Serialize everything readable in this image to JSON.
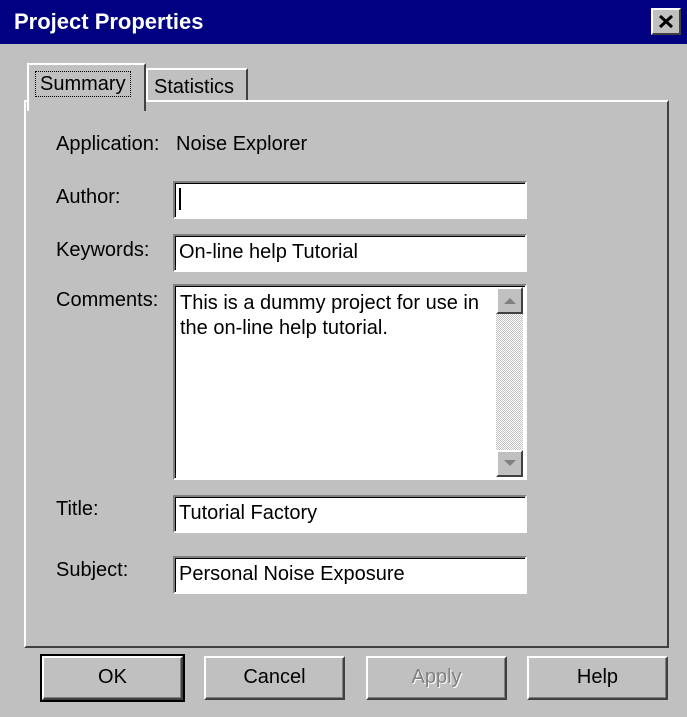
{
  "window": {
    "title": "Project Properties"
  },
  "tabs": [
    {
      "label": "Summary",
      "selected": true
    },
    {
      "label": "Statistics",
      "selected": false
    }
  ],
  "summary": {
    "application_label": "Application:",
    "application_value": "Noise Explorer",
    "author_label": "Author:",
    "author_value": "",
    "keywords_label": "Keywords:",
    "keywords_value": "On-line help Tutorial",
    "comments_label": "Comments:",
    "comments_value": "This is a dummy project for use in\nthe on-line help tutorial.",
    "title_label": "Title:",
    "title_value": "Tutorial Factory",
    "subject_label": "Subject:",
    "subject_value": "Personal Noise Exposure"
  },
  "buttons": {
    "ok": "OK",
    "cancel": "Cancel",
    "apply": "Apply",
    "help": "Help"
  },
  "icons": {
    "close": "close-icon",
    "scroll_up": "arrow-up-icon",
    "scroll_down": "arrow-down-icon"
  },
  "colors": {
    "titlebar": "#000080",
    "face": "#c0c0c0",
    "field": "#ffffff",
    "disabled_text": "#808080"
  }
}
